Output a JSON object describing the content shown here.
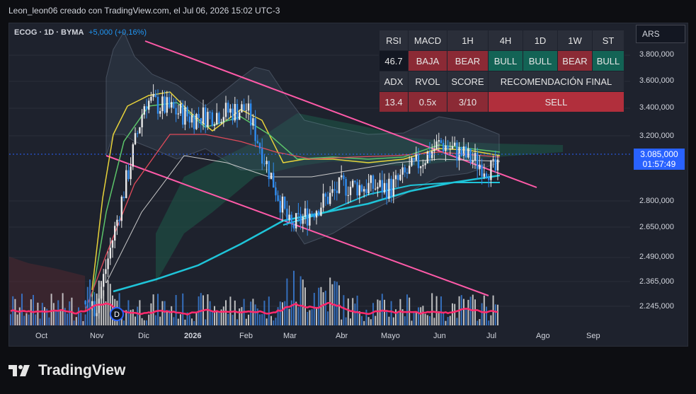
{
  "header": {
    "text": "Leon_leon06 creado con TradingView.com, el Jul 06, 2026 15:02 UTC-3"
  },
  "symbol": {
    "name": "ECOG · 1D · BYMA",
    "change": "+5,000 (+0,16%)"
  },
  "currency": "ARS",
  "last_price": {
    "price": "3.085,000",
    "countdown": "01:57:49"
  },
  "y_axis": [
    "3.800,000",
    "3.600,000",
    "3.400,000",
    "3.200,000",
    "2.800,000",
    "2.650,000",
    "2.490,000",
    "2.365,000",
    "2.245,000"
  ],
  "x_axis": [
    "Oct",
    "Nov",
    "Dic",
    "2026",
    "Feb",
    "Mar",
    "Abr",
    "Mayo",
    "Jun",
    "Jul",
    "Ago",
    "Sep"
  ],
  "marker": "D",
  "branding": "TradingView",
  "signal_table": {
    "row1": [
      "RSI",
      "MACD",
      "1H",
      "4H",
      "1D",
      "1W",
      "ST"
    ],
    "row2": [
      "46.7",
      "BAJA",
      "BEAR",
      "BULL",
      "BULL",
      "BEAR",
      "BULL"
    ],
    "row3": [
      "ADX",
      "RVOL",
      "SCORE",
      "RECOMENDACIÓN FINAL"
    ],
    "row4": [
      "13.4",
      "0.5x",
      "3/10",
      "SELL"
    ]
  },
  "colors": {
    "bull": "#136355",
    "bear": "#8b2a35",
    "sell": "#b12f3c",
    "candle_up": "#e8e8e8",
    "candle_down": "#2f8cf0",
    "trendline": "#ff5aa8",
    "ma_long": "#1fc4d8"
  },
  "chart_data": {
    "type": "line",
    "ylim": [
      2180,
      3950
    ],
    "x": [
      "Oct",
      "Nov",
      "Dic",
      "2026",
      "Feb",
      "Mar",
      "Abr",
      "Mayo",
      "Jun",
      "Jul"
    ],
    "series": [
      {
        "values": [
          2250,
          2300,
          3500,
          3400,
          3450,
          2750,
          3000,
          2990,
          3250,
          3085
        ]
      }
    ]
  }
}
